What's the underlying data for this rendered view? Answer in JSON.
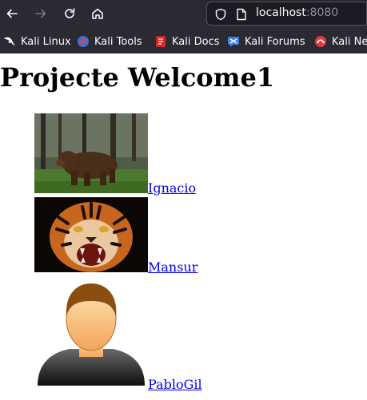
{
  "browser": {
    "url_host": "localhost",
    "url_port": ":8080",
    "icons": [
      "back-icon",
      "forward-icon",
      "reload-icon",
      "home-icon",
      "shield-icon",
      "page-icon"
    ]
  },
  "bookmarks": [
    {
      "label": "Kali Linux",
      "icon": "kali-dragon-icon"
    },
    {
      "label": "Kali Tools",
      "icon": "kali-tools-icon"
    },
    {
      "label": "Kali Docs",
      "icon": "kali-docs-icon"
    },
    {
      "label": "Kali Forums",
      "icon": "kali-forums-icon"
    },
    {
      "label": "Kali Ne",
      "icon": "kali-nethunter-icon"
    }
  ],
  "page": {
    "title": "Projecte Welcome1",
    "people": [
      {
        "name": "Ignacio",
        "image": "brown-bear-photo"
      },
      {
        "name": "Mansur",
        "image": "tiger-photo"
      },
      {
        "name": "PabloGil",
        "image": "avatar-placeholder"
      }
    ]
  }
}
